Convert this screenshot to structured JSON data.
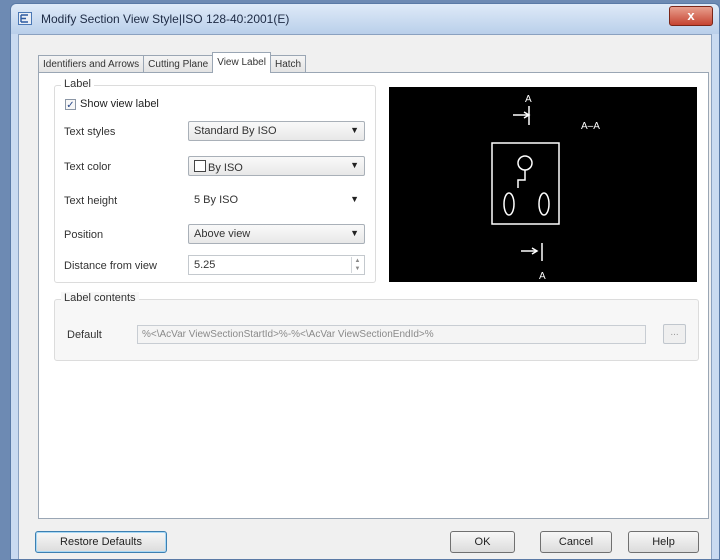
{
  "window": {
    "title": "Modify Section View Style|ISO 128-40:2001(E)",
    "close_label": "x"
  },
  "tabs": [
    {
      "label": "Identifiers and Arrows",
      "active": false
    },
    {
      "label": "Cutting Plane",
      "active": false
    },
    {
      "label": "View Label",
      "active": true
    },
    {
      "label": "Hatch",
      "active": false
    }
  ],
  "label_group": {
    "legend": "Label",
    "show_view_label": {
      "label": "Show view label",
      "checked": true,
      "mark": "✓"
    },
    "text_style": {
      "label": "Text styles",
      "value": "Standard By ISO"
    },
    "text_color": {
      "label": "Text color",
      "value": "By ISO"
    },
    "text_height": {
      "label": "Text height",
      "value": "5 By ISO"
    },
    "position": {
      "label": "Position",
      "value": "Above view"
    },
    "distance": {
      "label": "Distance from view",
      "value": "5.25"
    }
  },
  "preview": {
    "section_label": "A–A",
    "top_letter": "A",
    "bottom_letter": "A"
  },
  "label_contents": {
    "legend": "Label contents",
    "default_label": "Default",
    "default_value": "%<\\AcVar ViewSectionStartId>%-%<\\AcVar ViewSectionEndId>%",
    "ellipsis": "..."
  },
  "buttons": {
    "restore": "Restore Defaults",
    "ok": "OK",
    "cancel": "Cancel",
    "help": "Help"
  },
  "icons": {
    "dropdown": "chevron-down-icon",
    "app": "app-icon"
  }
}
